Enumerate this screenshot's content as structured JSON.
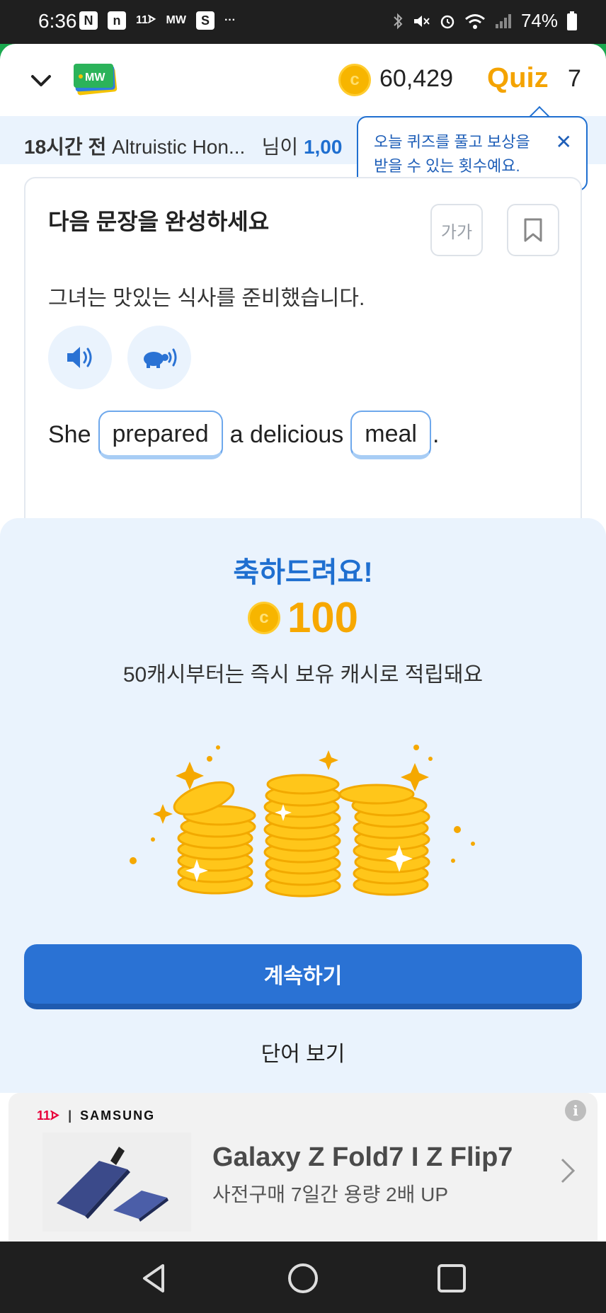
{
  "status_bar": {
    "time": "6:36",
    "app_icons": [
      "N",
      "n",
      "11ᗌ",
      "MW",
      "S",
      "···"
    ],
    "battery": "74%"
  },
  "header": {
    "logo_text": "MW",
    "coin_balance": "60,429",
    "quiz_label": "Quiz",
    "quiz_count": "7"
  },
  "ticker": {
    "time_ago": "18시간 전",
    "user": "Altruistic Hon...",
    "suffix": "님이",
    "amount": "1,00"
  },
  "tooltip": {
    "text_line1": "오늘 퀴즈를 풀고 보상을",
    "text_line2": "받을 수 있는 횟수예요."
  },
  "card": {
    "title": "다음 문장을 완성하세요",
    "font_button": "가가",
    "korean_sentence": "그녀는 맛있는 식사를 준비했습니다.",
    "sentence": {
      "w1": "She",
      "blank1": "prepared",
      "w2": "a delicious",
      "blank2": "meal",
      "end": "."
    }
  },
  "reward": {
    "title": "축하드려요!",
    "amount": "100",
    "note": "50캐시부터는 즉시 보유 캐시로 적립돼요",
    "continue_label": "계속하기",
    "view_words_label": "단어 보기"
  },
  "ad": {
    "brand_11st": "11ᗌ",
    "brand_samsung": "SAMSUNG",
    "title": "Galaxy Z Fold7 I Z Flip7",
    "subtitle": "사전구매 7일간 용량 2배 UP",
    "info": "i"
  },
  "colors": {
    "accent_blue": "#1f6fd0",
    "coin_gold": "#f7b500",
    "sheet_bg": "#eaf3fd"
  }
}
